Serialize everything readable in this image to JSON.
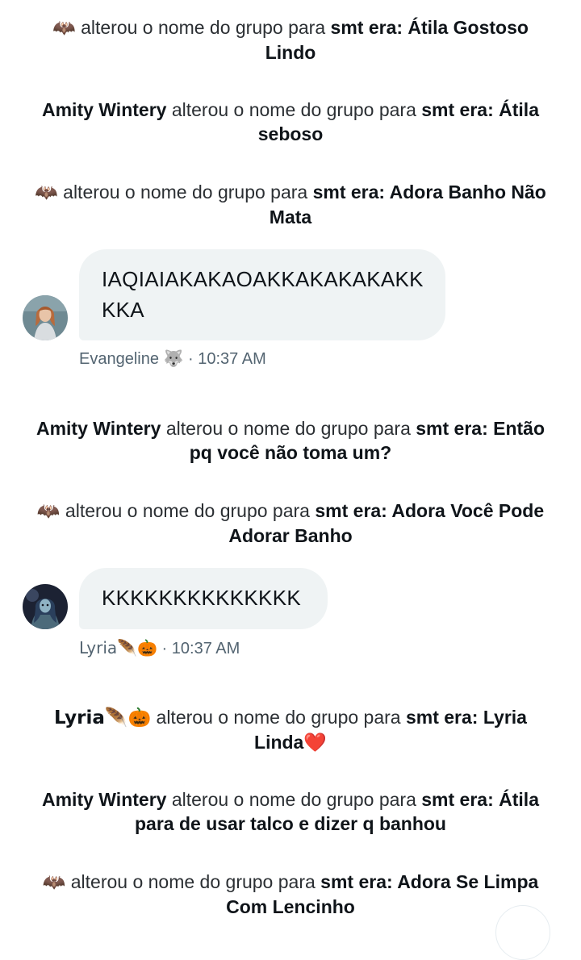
{
  "events": [
    {
      "actor": "🦇",
      "action": "alterou o nome do grupo para",
      "name": "smt era: Átila Gostoso Lindo"
    },
    {
      "actor": "Amity Wintery",
      "action": "alterou o nome do grupo para",
      "name": "smt era: Átila seboso"
    },
    {
      "actor": "🦇",
      "action": "alterou o nome do grupo para",
      "name": "smt era: Adora Banho Não Mata"
    },
    {
      "actor": "Amity Wintery",
      "action": "alterou o nome do grupo para",
      "name": "smt era: Então pq você não toma um?"
    },
    {
      "actor": "🦇",
      "action": "alterou o nome do grupo para",
      "name": "smt era: Adora Você Pode Adorar Banho"
    },
    {
      "actor": "Lyria🪶🎃",
      "action": "alterou o nome do grupo para",
      "name": "smt era: Lyria Linda❤️"
    },
    {
      "actor": "Amity Wintery",
      "action": "alterou o nome do grupo para",
      "name": "smt era: Átila para de usar talco e dizer q banhou"
    },
    {
      "actor": "🦇",
      "action": "alterou o nome do grupo para",
      "name": "smt era: Adora Se Limpa Com Lencinho"
    }
  ],
  "messages": [
    {
      "text": "IAQIAIAKAKAOAKKAKAKAKAKKKKA",
      "sender": "Evangeline 🐺",
      "time": "10:37 AM",
      "separator": "·"
    },
    {
      "text": "KKKKKKKKKKKKKK",
      "sender": "Lyria🪶🎃",
      "time": "10:37 AM",
      "separator": "·"
    }
  ],
  "colors": {
    "bubble": "#eff3f4",
    "meta_text": "#536471",
    "primary_text": "#0f1419"
  }
}
